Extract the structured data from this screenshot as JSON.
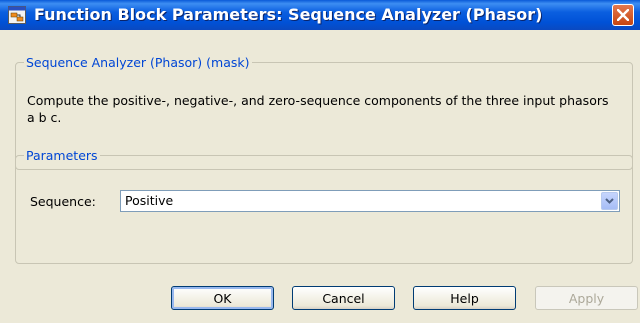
{
  "window": {
    "title": "Function Block Parameters: Sequence Analyzer (Phasor)",
    "title_color": "#0b5fe0",
    "close_icon": "close-icon"
  },
  "mask_group": {
    "legend": "Sequence Analyzer (Phasor) (mask)",
    "description": "Compute the positive-, negative-, and zero-sequence components of the three input phasors a b c."
  },
  "params_group": {
    "legend": "Parameters",
    "sequence_label": "Sequence:",
    "sequence_value": "Positive"
  },
  "buttons": {
    "ok": "OK",
    "cancel": "Cancel",
    "help": "Help",
    "apply": "Apply"
  }
}
